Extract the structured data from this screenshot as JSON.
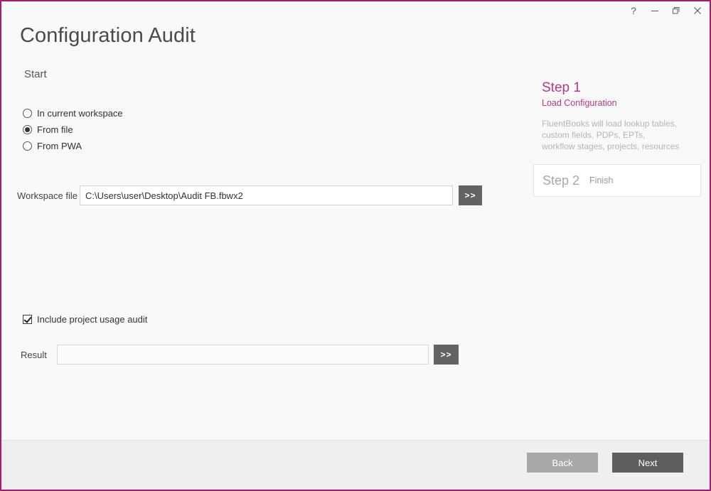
{
  "window": {
    "title": "Configuration Audit",
    "accent_color": "#a51d6e",
    "controls": {
      "help_label": "?",
      "minimize_label": "minimize-icon",
      "restore_label": "restore-icon",
      "close_label": "close-icon"
    }
  },
  "main": {
    "section_label": "Start",
    "source_options": [
      {
        "label": "In current workspace",
        "selected": false
      },
      {
        "label": "From file",
        "selected": true
      },
      {
        "label": "From PWA",
        "selected": false
      }
    ],
    "workspace_file": {
      "label": "Workspace file",
      "value": "C:\\Users\\user\\Desktop\\Audit FB.fbwx2",
      "placeholder": "",
      "browse_label": ">>"
    },
    "usage_audit": {
      "label": "Include project usage audit",
      "checked": true
    },
    "result": {
      "label": "Result",
      "value": "",
      "placeholder": "",
      "browse_label": ">>"
    }
  },
  "steps": {
    "accent_color": "#b43a83",
    "current": {
      "title": "Step 1",
      "subtitle": "Load Configuration",
      "description_lines": [
        "FluentBooks will load lookup tables,",
        "custom fields, PDPs, EPTs,",
        "workflow stages, projects, resources"
      ]
    },
    "next": {
      "title": "Step 2",
      "subtitle": "Finish"
    }
  },
  "footer": {
    "back_label": "Back",
    "next_label": "Next"
  }
}
